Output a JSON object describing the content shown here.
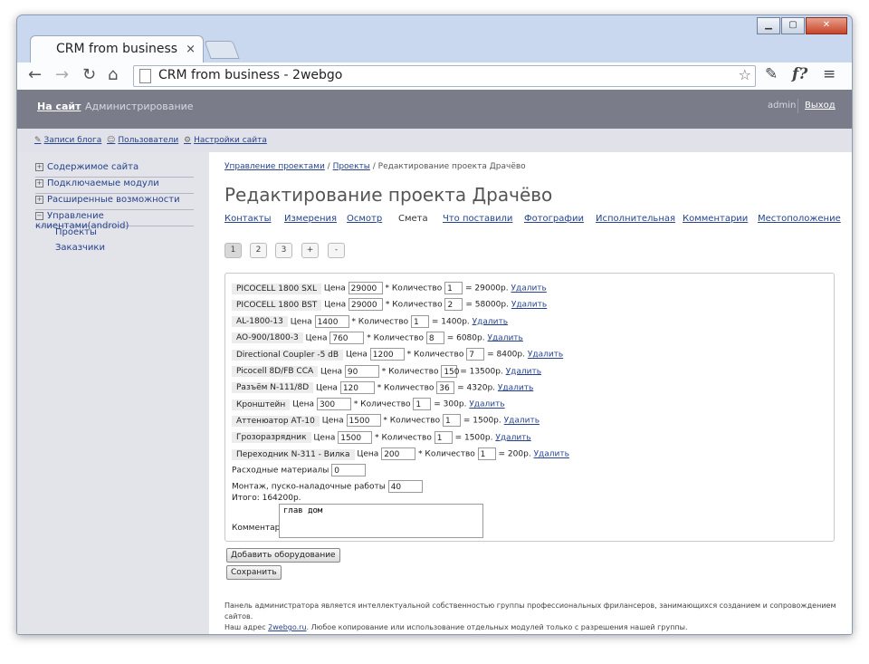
{
  "browser": {
    "tab_title": "CRM from business",
    "tab_close": "×",
    "url": "CRM from business - 2webgo",
    "ext_icon_text": "f?"
  },
  "adminbar": {
    "site_link": "На сайт",
    "admin_link": "Администрирование",
    "user": "admin",
    "logout": "Выход"
  },
  "subbar": {
    "items": [
      "Записи блога",
      "Пользователи",
      "Настройки сайта"
    ]
  },
  "sidebar": {
    "items": [
      {
        "label": "Содержимое сайта",
        "toggle": "+"
      },
      {
        "label": "Подключаемые модули",
        "toggle": "+"
      },
      {
        "label": "Расширенные возможности",
        "toggle": "+"
      },
      {
        "label": "Управление клиентами(android)",
        "toggle": "−"
      }
    ],
    "subitems": [
      "Проекты",
      "Заказчики"
    ]
  },
  "content": {
    "breadcrumb": {
      "link1": "Управление проектами",
      "sep1": " / ",
      "link2": "Проекты",
      "sep2": " / ",
      "current": "Редактирование проекта Драчёво"
    },
    "title": "Редактирование проекта Драчёво",
    "tabs": [
      "Контакты",
      "Измерения",
      "Осмотр",
      "Смета",
      "Что поставили",
      "Фотографии",
      "Исполнительная",
      "Комментарии",
      "Местоположение"
    ],
    "active_tab": "Смета",
    "pager": [
      "1",
      "2",
      "3",
      "+",
      "-"
    ],
    "labels": {
      "price": "Цена",
      "qty": "* Количество",
      "delete": "Удалить"
    },
    "items": [
      {
        "name": "PICOCELL 1800 SXL",
        "price": "29000",
        "qty": "1",
        "sum": "= 29000р."
      },
      {
        "name": "PICOCELL 1800 BST",
        "price": "29000",
        "qty": "2",
        "sum": "= 58000р."
      },
      {
        "name": "AL-1800-13",
        "price": "1400",
        "qty": "1",
        "sum": "= 1400р."
      },
      {
        "name": "AO-900/1800-3",
        "price": "760",
        "qty": "8",
        "sum": "= 6080р."
      },
      {
        "name": "Directional Coupler -5 dB",
        "price": "1200",
        "qty": "7",
        "sum": "= 8400р."
      },
      {
        "name": "Picocell 8D/FB CCA",
        "price": "90",
        "qty": "150",
        "sum": "= 13500р."
      },
      {
        "name": "Разъём N-111/8D",
        "price": "120",
        "qty": "36",
        "sum": "= 4320р."
      },
      {
        "name": "Кронштейн",
        "price": "300",
        "qty": "1",
        "sum": "= 300р."
      },
      {
        "name": "Аттенюатор АТ-10",
        "price": "1500",
        "qty": "1",
        "sum": "= 1500р."
      },
      {
        "name": "Грозоразрядник",
        "price": "1500",
        "qty": "1",
        "sum": "= 1500р."
      },
      {
        "name": "Переходник N-311 - Вилка",
        "price": "200",
        "qty": "1",
        "sum": "= 200р."
      }
    ],
    "consumables_label": "Расходные материалы",
    "consumables_value": "0",
    "install_label": "Монтаж, пуско-наладочные работы",
    "install_value": "40",
    "total": "Итого: 164200р.",
    "comment_label": "Комментарий",
    "comment_value": "глав дом",
    "add_button": "Добавить оборудование",
    "save_button": "Сохранить"
  },
  "footer": {
    "line1": "Панель администратора является интеллектуальной собственностью группы профессиональных фрилансеров, занимающихся созданием и сопровождением сайтов.",
    "line2_pre": "Наш адрес ",
    "line2_link": "2webgo.ru",
    "line2_post": ". Любое копирование или использование отдельных модулей только с разрешения нашей группы."
  }
}
